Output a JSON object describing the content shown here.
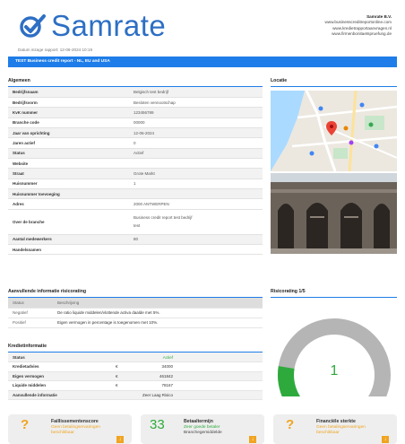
{
  "brand": {
    "name": "Samrate",
    "accent": "#2d6fc4"
  },
  "company": {
    "name": "Samrate B.V.",
    "lines": [
      "www.businesscreditreportonline.com",
      "www.kredietrapportaanvragen.nl",
      "www.firmenbonitaetspruefung.de"
    ]
  },
  "date_label": "Datum inzage rapport: 12-06-2024 10:19",
  "banner": "TEST Business credit report - NL, EU and USA",
  "general": {
    "title": "Algemeen",
    "rows": [
      {
        "k": "Bedrijfsnaam",
        "v": "Belgisch test bedrijf"
      },
      {
        "k": "Bedrijfsvorm",
        "v": "Besloten vennootschap"
      },
      {
        "k": "KvK nummer",
        "v": "123456789"
      },
      {
        "k": "Branche code",
        "v": "00000"
      },
      {
        "k": "Jaar van oprichting",
        "v": "12-06-2024"
      },
      {
        "k": "Jaren actief",
        "v": "0"
      },
      {
        "k": "Status",
        "v": "Actief"
      },
      {
        "k": "Website",
        "v": ""
      },
      {
        "k": "Straat",
        "v": "Grote Markt"
      },
      {
        "k": "Huisnummer",
        "v": "1"
      },
      {
        "k": "Huisnummer toevoeging",
        "v": ""
      },
      {
        "k": "Adres",
        "v": "2000 ANTWERPEN"
      }
    ],
    "branche_label": "Over de branche",
    "branche_value": "Business credit report test bedrijf",
    "branche_extra": "test",
    "rows2": [
      {
        "k": "Aantal medewerkers",
        "v": "80"
      },
      {
        "k": "Handelsnamen",
        "v": ""
      }
    ]
  },
  "location": {
    "title": "Locatie"
  },
  "risk": {
    "title": "Aanvullende informatie risicorating",
    "head": {
      "status": "Status",
      "desc": "Beschrijving"
    },
    "rows": [
      {
        "status": "Negatief",
        "desc": "De ratio liquide middelen/vlottende activa daalde met 5%."
      },
      {
        "status": "Positief",
        "desc": "Eigen vermogen in percentage is toegenomen met 10%."
      }
    ]
  },
  "credit": {
    "title": "Kredietinformatie",
    "rows": [
      {
        "k": "Status",
        "c": "",
        "n": "Actief"
      },
      {
        "k": "Kredietadvies",
        "c": "€",
        "n": "34000"
      },
      {
        "k": "Eigen vermogen",
        "c": "€",
        "n": "461842"
      },
      {
        "k": "Liquide middelen",
        "c": "€",
        "n": "78167"
      },
      {
        "k": "Aanvullende informatie",
        "c": "",
        "n": "Zeer Laag Risico"
      }
    ]
  },
  "rating": {
    "title": "Risicorating 1/5",
    "value": "1",
    "level": 0.2,
    "color": "#2eaa3d"
  },
  "cards": [
    {
      "big": "?",
      "title": "Faillissementenscore",
      "sub": [
        "Geen betalingservaringen",
        "beschikbaar"
      ],
      "color": "#f0a420"
    },
    {
      "big": "33",
      "title": "Betaaltermijn",
      "sub": [
        "Zeer goede betaler",
        "Branchegemiddelde"
      ],
      "color": "#2eaa3d"
    },
    {
      "big": "?",
      "title": "Financiële sterkte",
      "sub": [
        "Geen betalingservaringen",
        "beschikbaar"
      ],
      "color": "#f0a420"
    }
  ]
}
